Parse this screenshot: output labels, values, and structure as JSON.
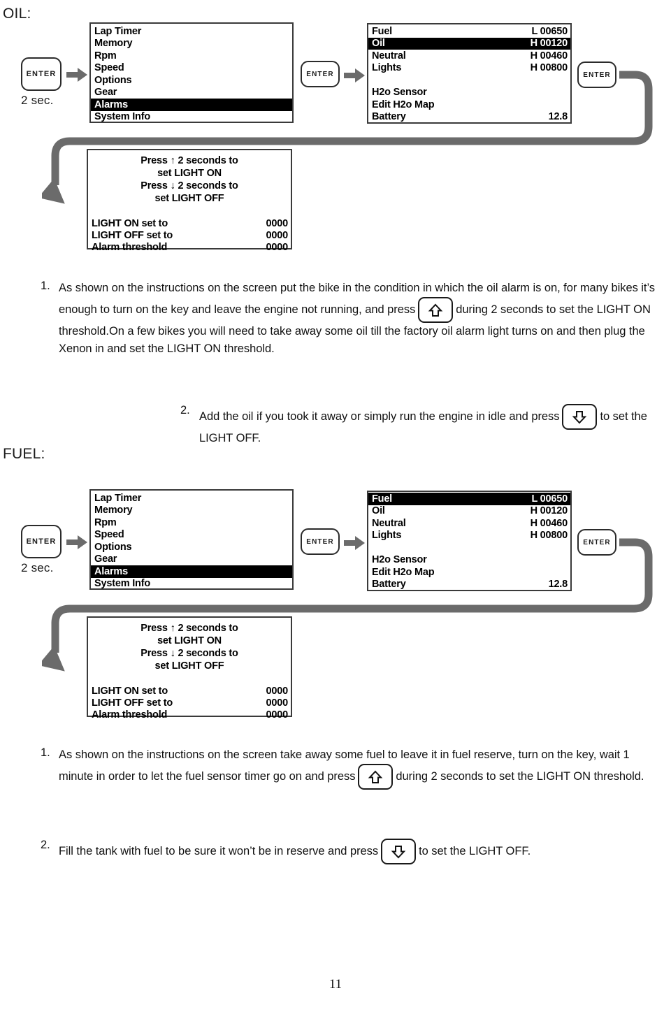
{
  "page": {
    "number": "11"
  },
  "sections": [
    {
      "id": "oil",
      "label": "OIL:",
      "diagram": {
        "enter_key_left": "ENTER",
        "hold_duration": "2 sec.",
        "enter_key_mid": "ENTER",
        "enter_key_right": "ENTER",
        "menu": {
          "items": [
            {
              "label": "Lap Timer",
              "value": "",
              "selected": false
            },
            {
              "label": "Memory",
              "value": "",
              "selected": false
            },
            {
              "label": "Rpm",
              "value": "",
              "selected": false
            },
            {
              "label": "Speed",
              "value": "",
              "selected": false
            },
            {
              "label": "Options",
              "value": "",
              "selected": false
            },
            {
              "label": "Gear",
              "value": "",
              "selected": false
            },
            {
              "label": "Alarms",
              "value": "",
              "selected": true
            },
            {
              "label": "System Info",
              "value": "",
              "selected": false
            }
          ]
        },
        "alarms": {
          "items": [
            {
              "label": "Fuel",
              "value": "L 00650",
              "selected": false
            },
            {
              "label": "Oil",
              "value": "H 00120",
              "selected": true
            },
            {
              "label": "Neutral",
              "value": "H 00460",
              "selected": false
            },
            {
              "label": "Lights",
              "value": "H 00800",
              "selected": false
            },
            {
              "label": "",
              "value": "",
              "selected": false
            },
            {
              "label": "H2o Sensor",
              "value": "",
              "selected": false
            },
            {
              "label": "Edit H2o Map",
              "value": "",
              "selected": false
            },
            {
              "label": "Battery",
              "value": "12.8",
              "selected": false
            }
          ]
        },
        "threshold": {
          "instruction_lines": [
            "Press ↑ 2 seconds to",
            "set LIGHT ON",
            "Press ↓ 2 seconds to",
            "set LIGHT OFF"
          ],
          "rows": [
            {
              "label": "LIGHT ON set to",
              "value": "0000"
            },
            {
              "label": "LIGHT OFF set to",
              "value": "0000"
            },
            {
              "label": "Alarm threshold",
              "value": "0000"
            }
          ]
        }
      },
      "steps": [
        {
          "number": "1.",
          "text_before_key": "As shown on the instructions on the screen put the bike in the condition in which the oil alarm is on, for many bikes it’s enough to turn on the key and leave the engine not running,  and press",
          "key_icon": "arrow-up-key-icon",
          "text_after_key": "during 2 seconds to set the LIGHT ON threshold.On a few bikes you will need to take away some oil till the factory oil alarm light turns on and then plug the Xenon in and set the LIGHT ON threshold."
        },
        {
          "number": "2.",
          "text_before_key": "Add the oil if you took it away or simply run the engine in idle and press",
          "key_icon": "arrow-down-key-icon",
          "text_after_key": "to set the LIGHT OFF."
        }
      ]
    },
    {
      "id": "fuel",
      "label": "FUEL:",
      "diagram": {
        "enter_key_left": "ENTER",
        "hold_duration": "2 sec.",
        "enter_key_mid": "ENTER",
        "enter_key_right": "ENTER",
        "menu": {
          "items": [
            {
              "label": "Lap Timer",
              "value": "",
              "selected": false
            },
            {
              "label": "Memory",
              "value": "",
              "selected": false
            },
            {
              "label": "Rpm",
              "value": "",
              "selected": false
            },
            {
              "label": "Speed",
              "value": "",
              "selected": false
            },
            {
              "label": "Options",
              "value": "",
              "selected": false
            },
            {
              "label": "Gear",
              "value": "",
              "selected": false
            },
            {
              "label": "Alarms",
              "value": "",
              "selected": true
            },
            {
              "label": "System Info",
              "value": "",
              "selected": false
            }
          ]
        },
        "alarms": {
          "items": [
            {
              "label": "Fuel",
              "value": "L 00650",
              "selected": true
            },
            {
              "label": "Oil",
              "value": "H 00120",
              "selected": false
            },
            {
              "label": "Neutral",
              "value": "H 00460",
              "selected": false
            },
            {
              "label": "Lights",
              "value": "H 00800",
              "selected": false
            },
            {
              "label": "",
              "value": "",
              "selected": false
            },
            {
              "label": "H2o Sensor",
              "value": "",
              "selected": false
            },
            {
              "label": "Edit H2o Map",
              "value": "",
              "selected": false
            },
            {
              "label": "Battery",
              "value": "12.8",
              "selected": false
            }
          ]
        },
        "threshold": {
          "instruction_lines": [
            "Press ↑ 2 seconds to",
            "set LIGHT ON",
            "Press ↓ 2 seconds to",
            "set LIGHT OFF"
          ],
          "rows": [
            {
              "label": "LIGHT ON set to",
              "value": "0000"
            },
            {
              "label": "LIGHT OFF set to",
              "value": "0000"
            },
            {
              "label": "Alarm threshold",
              "value": "0000"
            }
          ]
        }
      },
      "steps": [
        {
          "number": "1.",
          "text_before_key": "As shown on the instructions on the screen take away some fuel to leave it in fuel reserve, turn on  the key, wait 1 minute in order to let the fuel sensor timer go on and press",
          "key_icon": "arrow-up-key-icon",
          "text_after_key": "during 2 seconds to set the LIGHT ON threshold."
        },
        {
          "number": "2.",
          "text_before_key": "Fill the tank with fuel to be sure it won’t be in reserve and press",
          "key_icon": "arrow-down-key-icon",
          "text_after_key": "to set the LIGHT OFF."
        }
      ]
    }
  ],
  "colors": {
    "connector_grey": "#6b6b6b",
    "lcd_border": "#3a3a3a",
    "ink": "#111111"
  }
}
